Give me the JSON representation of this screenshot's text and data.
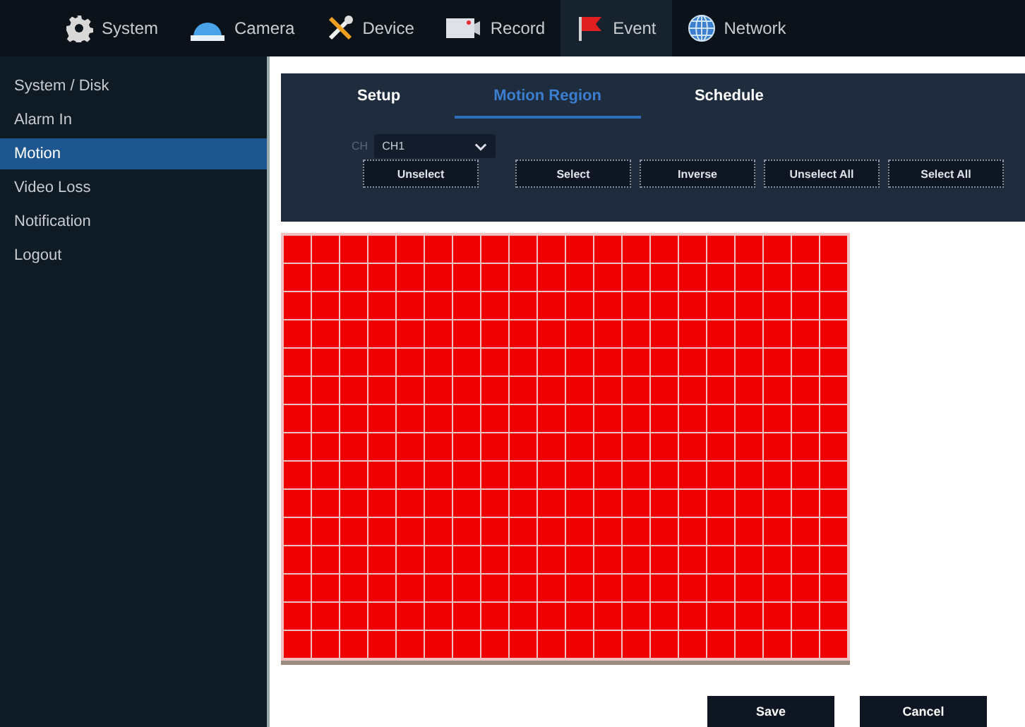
{
  "top_menu": [
    {
      "label": "System",
      "selected": false
    },
    {
      "label": "Camera",
      "selected": false
    },
    {
      "label": "Device",
      "selected": false
    },
    {
      "label": "Record",
      "selected": false
    },
    {
      "label": "Event",
      "selected": true
    },
    {
      "label": "Network",
      "selected": false
    }
  ],
  "sidebar": {
    "items": [
      {
        "label": "System / Disk",
        "selected": false
      },
      {
        "label": "Alarm In",
        "selected": false
      },
      {
        "label": "Motion",
        "selected": true
      },
      {
        "label": "Video Loss",
        "selected": false
      },
      {
        "label": "Notification",
        "selected": false
      },
      {
        "label": "Logout",
        "selected": false
      }
    ]
  },
  "tabs": [
    {
      "label": "Setup",
      "selected": false
    },
    {
      "label": "Motion Region",
      "selected": true
    },
    {
      "label": "Schedule",
      "selected": false
    }
  ],
  "channel": {
    "label": "CH",
    "value": "CH1"
  },
  "region_buttons": [
    "Unselect",
    "Select",
    "Inverse",
    "Unselect All",
    "Select All"
  ],
  "motion_grid": {
    "rows": [
      [
        true,
        true,
        true,
        true,
        true,
        true,
        true,
        true,
        true,
        true,
        true,
        true,
        true,
        true,
        true,
        true,
        true,
        true,
        true,
        true
      ],
      [
        true,
        true,
        true,
        true,
        true,
        true,
        true,
        true,
        true,
        true,
        true,
        true,
        true,
        true,
        true,
        true,
        true,
        true,
        true,
        true
      ],
      [
        true,
        true,
        true,
        true,
        true,
        true,
        true,
        true,
        true,
        true,
        true,
        true,
        true,
        true,
        true,
        true,
        true,
        true,
        true,
        true
      ],
      [
        true,
        true,
        true,
        true,
        true,
        true,
        true,
        true,
        true,
        true,
        true,
        true,
        true,
        true,
        true,
        true,
        true,
        true,
        true,
        true
      ],
      [
        true,
        true,
        true,
        true,
        true,
        true,
        true,
        true,
        true,
        true,
        true,
        true,
        true,
        true,
        true,
        true,
        true,
        true,
        true,
        true
      ],
      [
        true,
        true,
        true,
        true,
        true,
        true,
        true,
        true,
        true,
        true,
        true,
        true,
        true,
        true,
        true,
        true,
        true,
        true,
        true,
        true
      ],
      [
        true,
        true,
        true,
        true,
        true,
        true,
        true,
        true,
        true,
        true,
        true,
        true,
        true,
        true,
        true,
        true,
        true,
        true,
        true,
        true
      ],
      [
        true,
        true,
        true,
        true,
        true,
        true,
        true,
        true,
        true,
        true,
        true,
        true,
        true,
        true,
        true,
        true,
        true,
        true,
        true,
        true
      ],
      [
        true,
        true,
        true,
        true,
        true,
        true,
        true,
        true,
        true,
        true,
        true,
        true,
        true,
        true,
        true,
        true,
        true,
        true,
        true,
        true
      ],
      [
        true,
        true,
        true,
        true,
        true,
        true,
        true,
        true,
        true,
        true,
        true,
        true,
        true,
        true,
        true,
        true,
        true,
        true,
        true,
        true
      ],
      [
        true,
        true,
        true,
        true,
        true,
        true,
        true,
        true,
        true,
        true,
        true,
        true,
        true,
        true,
        true,
        true,
        true,
        true,
        true,
        true
      ],
      [
        true,
        true,
        true,
        true,
        true,
        true,
        true,
        true,
        true,
        true,
        true,
        true,
        true,
        true,
        true,
        true,
        true,
        true,
        true,
        true
      ],
      [
        true,
        true,
        true,
        true,
        true,
        true,
        true,
        true,
        true,
        true,
        true,
        true,
        true,
        true,
        true,
        true,
        true,
        true,
        true,
        true
      ],
      [
        true,
        true,
        true,
        true,
        true,
        true,
        true,
        true,
        true,
        true,
        true,
        true,
        true,
        true,
        true,
        true,
        true,
        true,
        true,
        true
      ],
      [
        true,
        true,
        true,
        true,
        true,
        true,
        true,
        true,
        true,
        true,
        true,
        true,
        true,
        true,
        true,
        true,
        true,
        true,
        true,
        true
      ]
    ]
  },
  "footer_buttons": [
    "Save",
    "Cancel"
  ]
}
